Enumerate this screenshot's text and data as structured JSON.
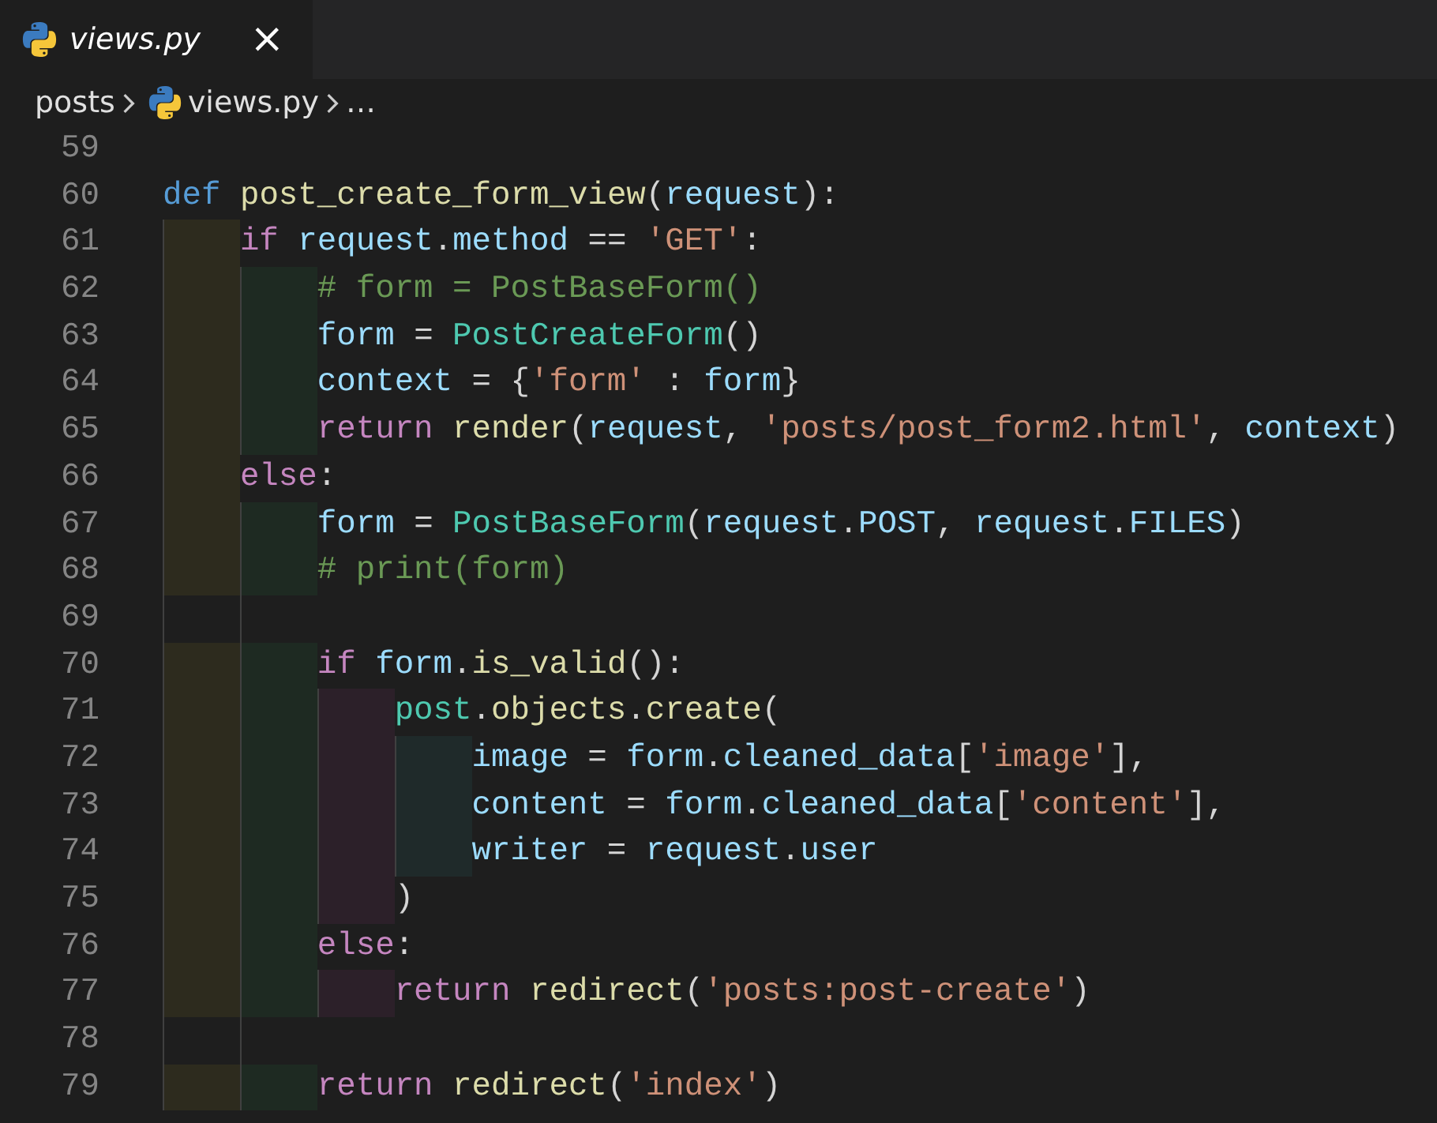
{
  "tab": {
    "title": "views.py",
    "preview": true,
    "close": "×"
  },
  "breadcrumb": {
    "folder": "posts",
    "file": "views.py",
    "more": "…"
  },
  "lines": [
    {
      "number": "59"
    },
    {
      "number": "60",
      "tokens": [
        {
          "kind": "kw",
          "text": "def "
        },
        {
          "kind": "fn",
          "text": "post_create_form_view"
        },
        {
          "kind": "pun",
          "text": "("
        },
        {
          "kind": "var",
          "text": "request"
        },
        {
          "kind": "pun",
          "text": "):"
        }
      ]
    },
    {
      "number": "61",
      "tokens": [
        {
          "kind": "ctl",
          "text": "    if "
        },
        {
          "kind": "var",
          "text": "request"
        },
        {
          "kind": "pun",
          "text": "."
        },
        {
          "kind": "var",
          "text": "method"
        },
        {
          "kind": "pun",
          "text": " == "
        },
        {
          "kind": "str",
          "text": "'GET'"
        },
        {
          "kind": "pun",
          "text": ":"
        }
      ]
    },
    {
      "number": "62",
      "tokens": [
        {
          "kind": "cmt",
          "text": "        # form = PostBaseForm()"
        }
      ]
    },
    {
      "number": "63",
      "tokens": [
        {
          "kind": "var",
          "text": "        form"
        },
        {
          "kind": "pun",
          "text": " = "
        },
        {
          "kind": "cls",
          "text": "PostCreateForm"
        },
        {
          "kind": "pun",
          "text": "()"
        }
      ]
    },
    {
      "number": "64",
      "tokens": [
        {
          "kind": "var",
          "text": "        context"
        },
        {
          "kind": "pun",
          "text": " = {"
        },
        {
          "kind": "str",
          "text": "'form'"
        },
        {
          "kind": "pun",
          "text": " : "
        },
        {
          "kind": "var",
          "text": "form"
        },
        {
          "kind": "pun",
          "text": "}"
        }
      ]
    },
    {
      "number": "65",
      "tokens": [
        {
          "kind": "ctl",
          "text": "        return "
        },
        {
          "kind": "fn",
          "text": "render"
        },
        {
          "kind": "pun",
          "text": "("
        },
        {
          "kind": "var",
          "text": "request"
        },
        {
          "kind": "pun",
          "text": ", "
        },
        {
          "kind": "str",
          "text": "'posts/post_form2.html'"
        },
        {
          "kind": "pun",
          "text": ", "
        },
        {
          "kind": "var",
          "text": "context"
        },
        {
          "kind": "pun",
          "text": ")"
        }
      ]
    },
    {
      "number": "66",
      "tokens": [
        {
          "kind": "ctl",
          "text": "    else"
        },
        {
          "kind": "pun",
          "text": ":"
        }
      ]
    },
    {
      "number": "67",
      "tokens": [
        {
          "kind": "var",
          "text": "        form"
        },
        {
          "kind": "pun",
          "text": " = "
        },
        {
          "kind": "cls",
          "text": "PostBaseForm"
        },
        {
          "kind": "pun",
          "text": "("
        },
        {
          "kind": "var",
          "text": "request"
        },
        {
          "kind": "pun",
          "text": "."
        },
        {
          "kind": "var",
          "text": "POST"
        },
        {
          "kind": "pun",
          "text": ", "
        },
        {
          "kind": "var",
          "text": "request"
        },
        {
          "kind": "pun",
          "text": "."
        },
        {
          "kind": "var",
          "text": "FILES"
        },
        {
          "kind": "pun",
          "text": ")"
        }
      ]
    },
    {
      "number": "68",
      "tokens": [
        {
          "kind": "cmt",
          "text": "        # print(form)"
        }
      ]
    },
    {
      "number": "69"
    },
    {
      "number": "70",
      "tokens": [
        {
          "kind": "ctl",
          "text": "        if "
        },
        {
          "kind": "var",
          "text": "form"
        },
        {
          "kind": "pun",
          "text": "."
        },
        {
          "kind": "fn",
          "text": "is_valid"
        },
        {
          "kind": "pun",
          "text": "():"
        }
      ]
    },
    {
      "number": "71",
      "tokens": [
        {
          "kind": "cls",
          "text": "            post"
        },
        {
          "kind": "pun",
          "text": "."
        },
        {
          "kind": "attr",
          "text": "objects"
        },
        {
          "kind": "pun",
          "text": "."
        },
        {
          "kind": "fn",
          "text": "create"
        },
        {
          "kind": "pun",
          "text": "("
        }
      ]
    },
    {
      "number": "72",
      "tokens": [
        {
          "kind": "var",
          "text": "                image"
        },
        {
          "kind": "pun",
          "text": " = "
        },
        {
          "kind": "var",
          "text": "form"
        },
        {
          "kind": "pun",
          "text": "."
        },
        {
          "kind": "var",
          "text": "cleaned_data"
        },
        {
          "kind": "pun",
          "text": "["
        },
        {
          "kind": "str",
          "text": "'image'"
        },
        {
          "kind": "pun",
          "text": "],"
        }
      ]
    },
    {
      "number": "73",
      "tokens": [
        {
          "kind": "var",
          "text": "                content"
        },
        {
          "kind": "pun",
          "text": " = "
        },
        {
          "kind": "var",
          "text": "form"
        },
        {
          "kind": "pun",
          "text": "."
        },
        {
          "kind": "var",
          "text": "cleaned_data"
        },
        {
          "kind": "pun",
          "text": "["
        },
        {
          "kind": "str",
          "text": "'content'"
        },
        {
          "kind": "pun",
          "text": "],"
        }
      ]
    },
    {
      "number": "74",
      "tokens": [
        {
          "kind": "var",
          "text": "                writer"
        },
        {
          "kind": "pun",
          "text": " = "
        },
        {
          "kind": "var",
          "text": "request"
        },
        {
          "kind": "pun",
          "text": "."
        },
        {
          "kind": "var",
          "text": "user"
        }
      ]
    },
    {
      "number": "75",
      "tokens": [
        {
          "kind": "pun",
          "text": "            )"
        }
      ]
    },
    {
      "number": "76",
      "tokens": [
        {
          "kind": "ctl",
          "text": "        else"
        },
        {
          "kind": "pun",
          "text": ":"
        }
      ]
    },
    {
      "number": "77",
      "tokens": [
        {
          "kind": "ctl",
          "text": "            return "
        },
        {
          "kind": "fn",
          "text": "redirect"
        },
        {
          "kind": "pun",
          "text": "("
        },
        {
          "kind": "str",
          "text": "'posts:post-create'"
        },
        {
          "kind": "pun",
          "text": ")"
        }
      ]
    },
    {
      "number": "78"
    },
    {
      "number": "79",
      "tokens": [
        {
          "kind": "ctl",
          "text": "        return "
        },
        {
          "kind": "fn",
          "text": "redirect"
        },
        {
          "kind": "pun",
          "text": "("
        },
        {
          "kind": "str",
          "text": "'index'"
        },
        {
          "kind": "pun",
          "text": ")"
        }
      ]
    }
  ]
}
